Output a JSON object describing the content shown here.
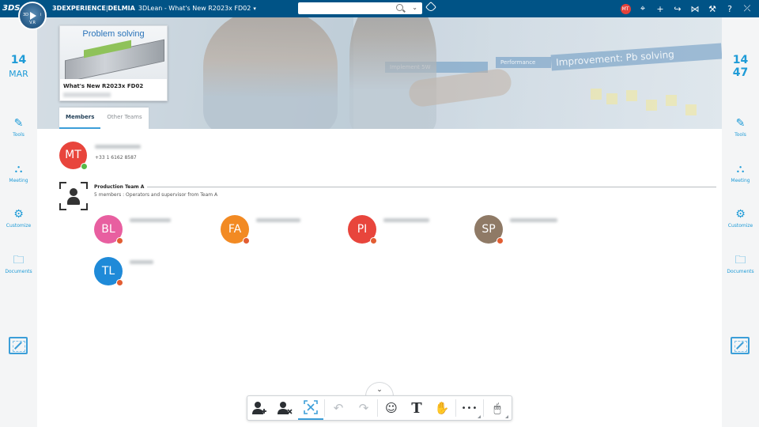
{
  "topbar": {
    "brand_3dx": "3DEXPERIENCE",
    "brand_sep": " | ",
    "brand_delmia": "DELMIA",
    "app_name": "3DLean - What's New R2023x FD02",
    "compass_label": "V.R",
    "compass_quadrant_left": "3D",
    "compass_quadrant_right": "i",
    "user_initials": "MT",
    "icons": [
      "user-avatar",
      "tag-icon",
      "plus-icon",
      "share-icon",
      "network-icon",
      "tools-icon",
      "help-icon",
      "collapse-icon"
    ]
  },
  "left_panel": {
    "day": "14",
    "month": "MAR",
    "items": [
      {
        "label": "Tools",
        "icon": "tools-icon"
      },
      {
        "label": "Meeting",
        "icon": "meeting-icon"
      },
      {
        "label": "Customize",
        "icon": "gear-icon"
      },
      {
        "label": "Documents",
        "icon": "folder-icon"
      }
    ]
  },
  "right_panel": {
    "hour": "14",
    "minute": "47",
    "items": [
      {
        "label": "Tools",
        "icon": "tools-icon"
      },
      {
        "label": "Meeting",
        "icon": "meeting-icon"
      },
      {
        "label": "Customize",
        "icon": "gear-icon"
      },
      {
        "label": "Documents",
        "icon": "folder-icon"
      }
    ]
  },
  "banner": {
    "strip1": "Improvement: Pb solving",
    "strip2": "Implement 5W",
    "strip3": "Performance"
  },
  "card": {
    "image_title": "Problem solving",
    "name": "What's New R2023x FD02"
  },
  "tabs": [
    {
      "label": "Members",
      "active": true
    },
    {
      "label": "Other Teams",
      "active": false
    }
  ],
  "owner": {
    "initials": "MT",
    "phone": "+33 1 6162 8587",
    "status_color": "#57b847",
    "avatar_color": "#e8453c"
  },
  "team": {
    "name": "Production Team A",
    "description": "5 members : Operators and supervisor from Team A",
    "members": [
      {
        "initials": "BL",
        "color": "#e85fa0"
      },
      {
        "initials": "FA",
        "color": "#f28a23"
      },
      {
        "initials": "PI",
        "color": "#e8453c"
      },
      {
        "initials": "SP",
        "color": "#8f7a66"
      },
      {
        "initials": "TL",
        "color": "#1f8ad8"
      }
    ],
    "status_color": "#e25d32"
  },
  "toolbar": {
    "chevron": "⌄",
    "items": [
      "add-member-icon",
      "remove-member-icon",
      "collapse-icon",
      "undo-icon",
      "redo-icon",
      "sticker-icon",
      "text-icon",
      "hand-icon",
      "more-icon",
      "pointer-icon"
    ],
    "text_glyph": "T",
    "more_glyph": "•••"
  },
  "colors": {
    "topbar": "#005386",
    "accent": "#1e9bd7"
  }
}
